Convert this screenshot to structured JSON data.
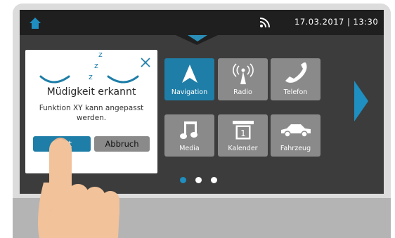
{
  "status_bar": {
    "datetime": "17.03.2017 | 13:30",
    "home_icon": "home-icon",
    "signal_icon": "wireless-signal-icon"
  },
  "dialog": {
    "title": "Müdigkeit erkannt",
    "text": "Funktion XY kann angepasst werden.",
    "start_label": "Start",
    "cancel_label": "Abbruch",
    "icons": [
      "sleeping-face-icon",
      "close-icon"
    ],
    "sleep_letters": [
      "z",
      "z",
      "z"
    ]
  },
  "apps": [
    {
      "label": "Navigation",
      "icon": "navigation-arrow-icon",
      "active": true
    },
    {
      "label": "Radio",
      "icon": "radio-antenna-icon"
    },
    {
      "label": "Telefon",
      "icon": "phone-handset-icon"
    },
    {
      "label": "Media",
      "icon": "music-note-icon"
    },
    {
      "label": "Kalender",
      "icon": "calendar-icon",
      "badge": "1"
    },
    {
      "label": "Fahrzeug",
      "icon": "car-icon"
    }
  ],
  "pagination": {
    "pages": 3,
    "current": 1
  },
  "colors": {
    "accent": "#1e7ea8",
    "tile": "#8a8a8a",
    "screen": "#3c3c3c",
    "status_bar": "#1f1f1f",
    "skin": "#f2c29a"
  }
}
